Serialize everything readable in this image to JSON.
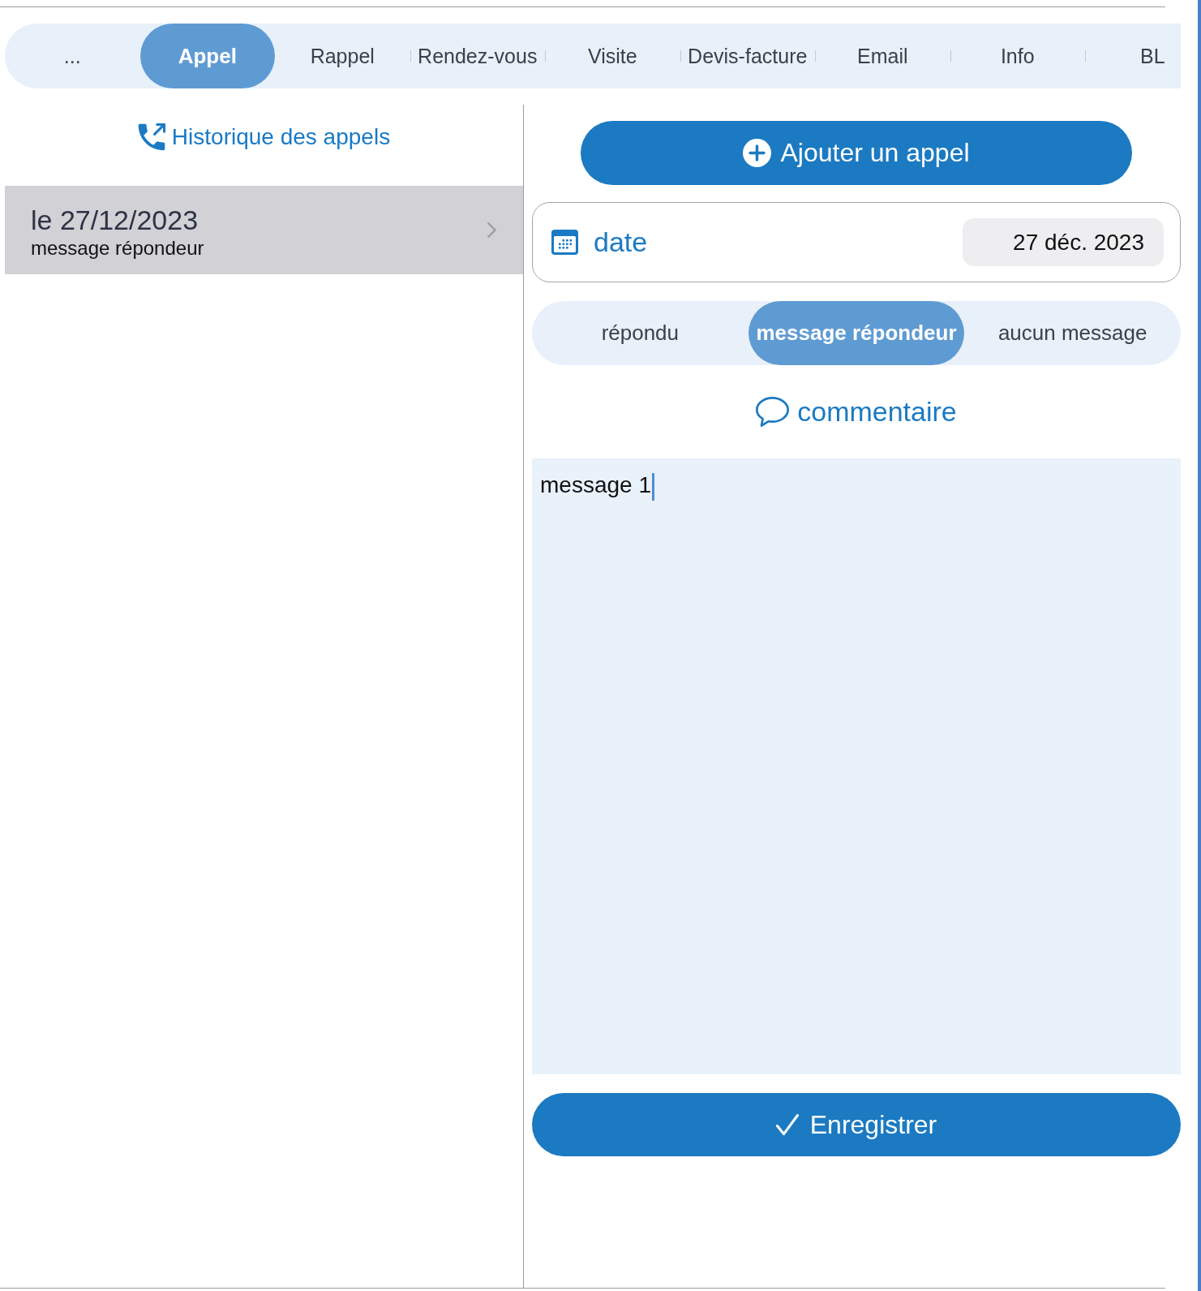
{
  "tabs": [
    {
      "label": "...",
      "selected": false
    },
    {
      "label": "Appel",
      "selected": true
    },
    {
      "label": "Rappel",
      "selected": false
    },
    {
      "label": "Rendez-vous",
      "selected": false
    },
    {
      "label": "Visite",
      "selected": false
    },
    {
      "label": "Devis-facture",
      "selected": false
    },
    {
      "label": "Email",
      "selected": false
    },
    {
      "label": "Info",
      "selected": false
    },
    {
      "label": "BL",
      "selected": false
    }
  ],
  "history": {
    "title": "Historique des appels",
    "items": [
      {
        "date": "le 27/12/2023",
        "status": "message répondeur",
        "selected": true
      }
    ]
  },
  "add_button": {
    "label": "Ajouter un appel"
  },
  "date_field": {
    "label": "date",
    "value": "27 déc. 2023"
  },
  "response_options": [
    {
      "label": "répondu",
      "selected": false
    },
    {
      "label": "message répondeur",
      "selected": true
    },
    {
      "label": "aucun message",
      "selected": false
    }
  ],
  "comment": {
    "label": "commentaire",
    "value": "message 1",
    "focused": true
  },
  "save_button": {
    "label": "Enregistrer"
  }
}
